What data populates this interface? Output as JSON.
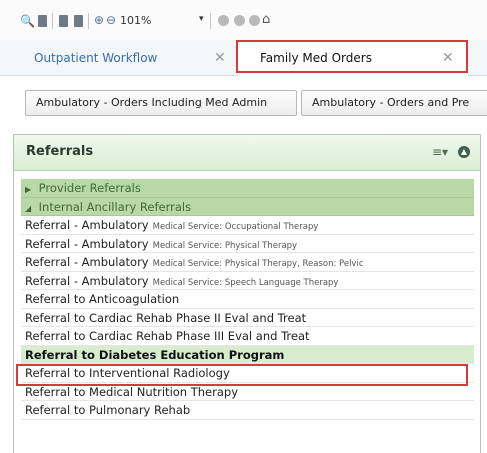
{
  "toolbar": {
    "zoom_value": "101%",
    "icons": [
      "binoculars-icon",
      "page-icon",
      "page-icon",
      "page-icon",
      "zoom-in-icon",
      "zoom-out-icon",
      "circle-icon",
      "circle-icon",
      "home-icon"
    ]
  },
  "tabs": [
    {
      "label": "Outpatient Workflow",
      "close": "✕"
    },
    {
      "label": "Family Med Orders",
      "close": "✕"
    }
  ],
  "ordersets": [
    {
      "label": "Ambulatory - Orders Including Med Admin"
    },
    {
      "label": "Ambulatory - Orders and Pre"
    }
  ],
  "panel": {
    "title": "Referrals",
    "menu_symbol": "≡▾",
    "collapse_symbol": "▲"
  },
  "groups": [
    {
      "arrow": "▶",
      "label": "Provider Referrals"
    },
    {
      "arrow": "◢",
      "label": "Internal Ancillary Referrals"
    }
  ],
  "items": [
    {
      "label": "Referral - Ambulatory",
      "detail": "Medical Service: Occupational Therapy"
    },
    {
      "label": "Referral - Ambulatory",
      "detail": "Medical Service: Physical Therapy"
    },
    {
      "label": "Referral - Ambulatory",
      "detail": "Medical Service: Physical Therapy, Reason: Pelvic"
    },
    {
      "label": "Referral - Ambulatory",
      "detail": "Medical Service: Speech Language Therapy"
    },
    {
      "label": "Referral to Anticoagulation",
      "detail": ""
    },
    {
      "label": "Referral to Cardiac Rehab Phase II Eval and Treat",
      "detail": ""
    },
    {
      "label": "Referral to Cardiac Rehab Phase III Eval and Treat",
      "detail": ""
    },
    {
      "label": "Referral to Diabetes Education Program",
      "detail": ""
    },
    {
      "label": "Referral to Interventional Radiology",
      "detail": ""
    },
    {
      "label": "Referral to Medical Nutrition Therapy",
      "detail": ""
    },
    {
      "label": "Referral to Pulmonary Rehab",
      "detail": ""
    }
  ],
  "colors": {
    "highlight": "#d63b3b",
    "group_bg": "#b9d8a8",
    "tab_link": "#3a6ea8"
  }
}
